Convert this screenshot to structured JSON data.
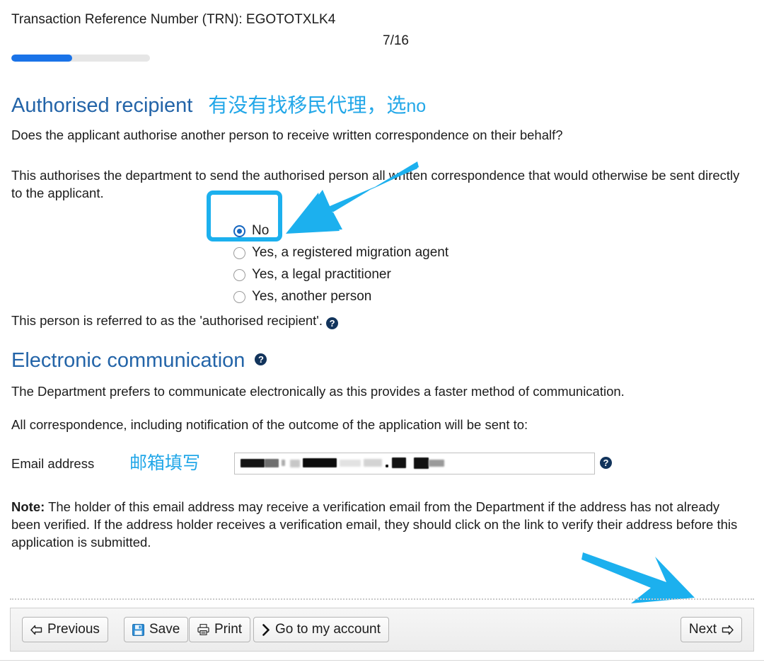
{
  "header": {
    "trn_text": "Transaction Reference Number (TRN): EGOTOTXLK4",
    "page_count": "7/16",
    "progress_percent": 44
  },
  "colors": {
    "heading_blue": "#2364a8",
    "annotation_cyan": "#22a7e8",
    "highlight_cyan": "#1cb0ee",
    "progress_blue": "#1a73e8",
    "help_icon_navy": "#12345c"
  },
  "sections": {
    "authorised_recipient": {
      "heading": "Authorised recipient",
      "annotation_cn": "有没有找移民代理，选",
      "annotation_cn_latin": "no",
      "question": "Does the applicant authorise another person to receive written correspondence on their behalf?",
      "explanation": "This authorises the department to send the authorised person all written correspondence that would otherwise be sent directly to the applicant.",
      "options": [
        {
          "label": "No",
          "selected": true
        },
        {
          "label": "Yes, a registered migration agent",
          "selected": false
        },
        {
          "label": "Yes, a legal practitioner",
          "selected": false
        },
        {
          "label": "Yes, another person",
          "selected": false
        }
      ],
      "footnote": "This person is referred to as the 'authorised recipient'.",
      "footnote_help": "?"
    },
    "electronic_communication": {
      "heading": "Electronic communication",
      "heading_help": "?",
      "paragraph_1": "The Department prefers to communicate electronically as this provides a faster method of communication.",
      "paragraph_2": "All correspondence, including notification of the outcome of the application will be sent to:",
      "email_label": "Email address",
      "email_annotation_cn": "邮箱填写",
      "email_value": "",
      "email_placeholder": "",
      "email_help": "?",
      "note_prefix": "Note:",
      "note_text": " The holder of this email address may receive a verification email from the Department if the address has not already been verified. If the address holder receives a verification email, they should click on the link to verify their address before this application is submitted."
    }
  },
  "footer": {
    "buttons": [
      {
        "id": "previous",
        "label": "Previous",
        "icon": "arrow-left-outline-icon"
      },
      {
        "id": "save",
        "label": "Save",
        "icon": "floppy-disk-icon"
      },
      {
        "id": "print",
        "label": "Print",
        "icon": "printer-icon"
      },
      {
        "id": "account",
        "label": "Go to my account",
        "icon": "chevron-right-icon"
      }
    ],
    "next_label": "Next",
    "next_icon": "arrow-right-outline-icon"
  },
  "annotations": {
    "arrow_to_no_option": "down-left-arrow",
    "arrow_to_next_button": "down-right-arrow"
  }
}
